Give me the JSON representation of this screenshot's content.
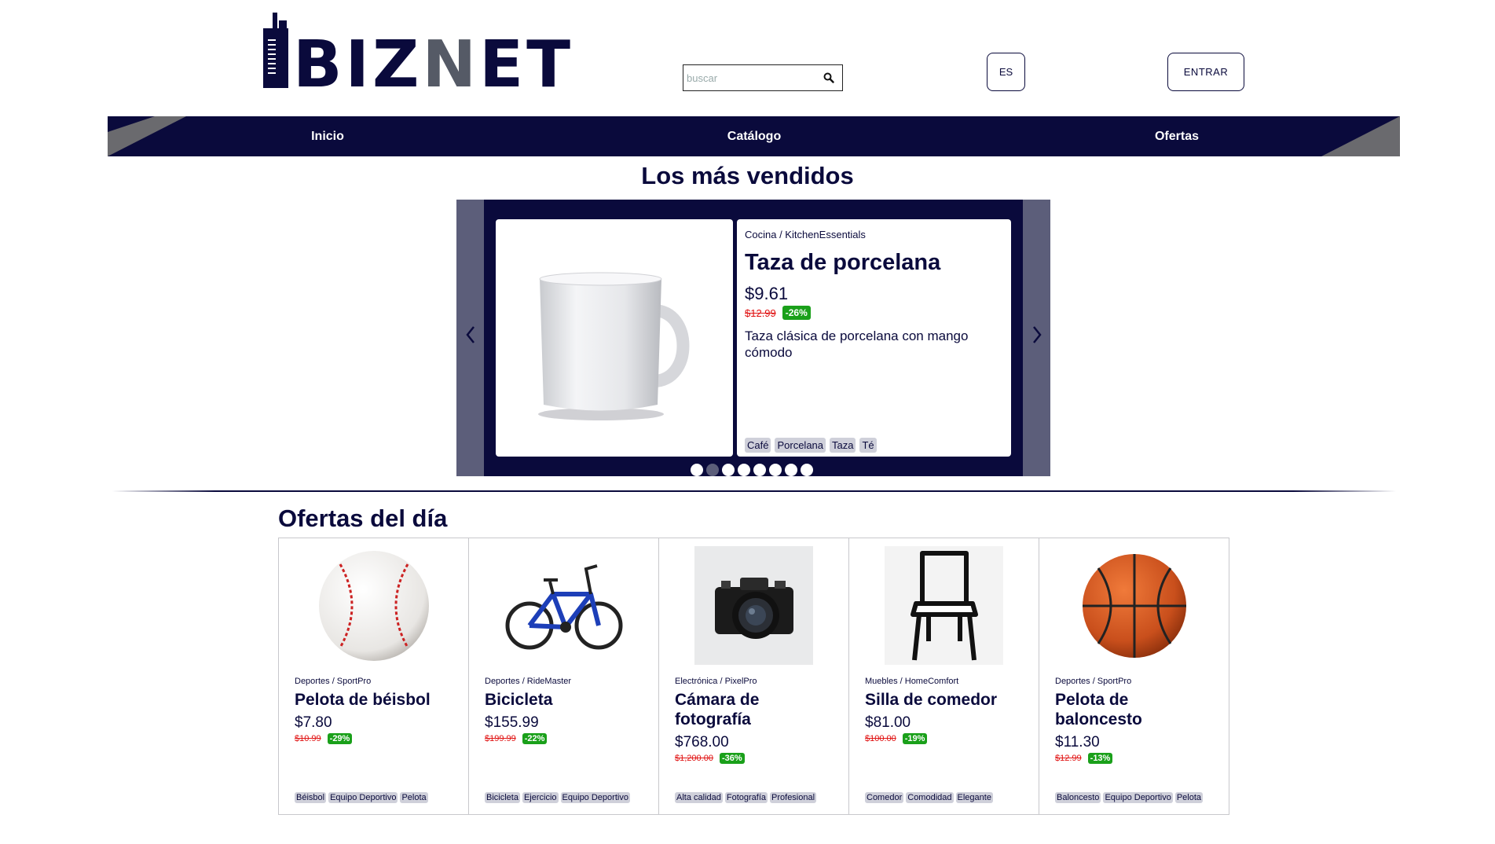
{
  "header": {
    "logo_text_a": "BIZ",
    "logo_text_n": "N",
    "logo_text_b": "ET",
    "search_placeholder": "buscar",
    "lang_label": "ES",
    "enter_label": "ENTRAR"
  },
  "nav": {
    "items": [
      {
        "label": "Inicio"
      },
      {
        "label": "Catálogo"
      },
      {
        "label": "Ofertas"
      }
    ]
  },
  "best_sellers": {
    "title": "Los más vendidos",
    "slide": {
      "category": "Cocina / KitchenEssentials",
      "title": "Taza de porcelana",
      "price": "$9.61",
      "old_price": "$12.99",
      "discount": "-26%",
      "description": "Taza clásica de porcelana con mango cómodo",
      "tags": [
        "Café",
        "Porcelana",
        "Taza",
        "Té"
      ]
    },
    "slide_count": 8,
    "active_slide": 1
  },
  "offers": {
    "title": "Ofertas del día",
    "cards": [
      {
        "category": "Deportes / SportPro",
        "title": "Pelota de béisbol",
        "price": "$7.80",
        "old_price": "$10.99",
        "discount": "-29%",
        "tags": [
          "Béisbol",
          "Equipo Deportivo",
          "Pelota"
        ],
        "image": "baseball-image"
      },
      {
        "category": "Deportes / RideMaster",
        "title": "Bicicleta",
        "price": "$155.99",
        "old_price": "$199.99",
        "discount": "-22%",
        "tags": [
          "Bicicleta",
          "Ejercicio",
          "Equipo Deportivo"
        ],
        "image": "bicycle-image"
      },
      {
        "category": "Electrónica / PixelPro",
        "title": "Cámara de fotografía",
        "price": "$768.00",
        "old_price": "$1,200.00",
        "discount": "-36%",
        "tags": [
          "Alta calidad",
          "Fotografía",
          "Profesional"
        ],
        "image": "camera-image"
      },
      {
        "category": "Muebles / HomeComfort",
        "title": "Silla de comedor",
        "price": "$81.00",
        "old_price": "$100.00",
        "discount": "-19%",
        "tags": [
          "Comedor",
          "Comodidad",
          "Elegante"
        ],
        "image": "chair-image"
      },
      {
        "category": "Deportes / SportPro",
        "title": "Pelota de baloncesto",
        "price": "$11.30",
        "old_price": "$12.99",
        "discount": "-13%",
        "tags": [
          "Baloncesto",
          "Equipo Deportivo",
          "Pelota"
        ],
        "image": "basketball-image"
      }
    ]
  },
  "colors": {
    "brand": "#0a0a3c",
    "accent_gray": "#5c5e7a",
    "discount_green": "#1aa01a",
    "old_price_red": "#e01010"
  }
}
